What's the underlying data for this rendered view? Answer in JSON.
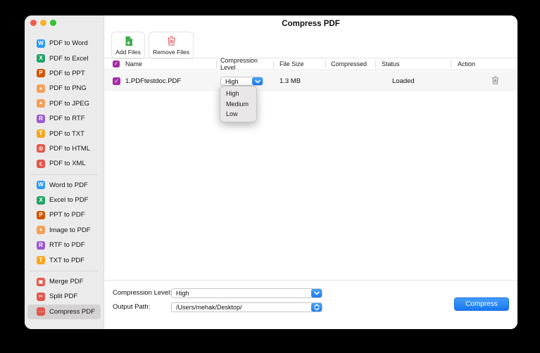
{
  "window": {
    "title": "Compress PDF"
  },
  "toolbar": {
    "add_files_label": "Add Files",
    "remove_files_label": "Remove Files"
  },
  "sidebar": {
    "groups": [
      {
        "items": [
          {
            "label": "PDF to Word",
            "glyph": "W",
            "color": "#2b9af3"
          },
          {
            "label": "PDF to Excel",
            "glyph": "X",
            "color": "#21a366"
          },
          {
            "label": "PDF to PPT",
            "glyph": "P",
            "color": "#d35400"
          },
          {
            "label": "PDF to PNG",
            "glyph": "▲",
            "color": "#f5a05a"
          },
          {
            "label": "PDF to JPEG",
            "glyph": "▲",
            "color": "#f5a05a"
          },
          {
            "label": "PDF to RTF",
            "glyph": "R",
            "color": "#9b59d0"
          },
          {
            "label": "PDF to TXT",
            "glyph": "T",
            "color": "#f6a821"
          },
          {
            "label": "PDF to HTML",
            "glyph": "⊕",
            "color": "#e2574c"
          },
          {
            "label": "PDF to XML",
            "glyph": "ς",
            "color": "#e2574c"
          }
        ]
      },
      {
        "items": [
          {
            "label": "Word to PDF",
            "glyph": "W",
            "color": "#2b9af3"
          },
          {
            "label": "Excel to PDF",
            "glyph": "X",
            "color": "#21a366"
          },
          {
            "label": "PPT to PDF",
            "glyph": "P",
            "color": "#d35400"
          },
          {
            "label": "Image to PDF",
            "glyph": "▲",
            "color": "#f5a05a"
          },
          {
            "label": "RTF to PDF",
            "glyph": "R",
            "color": "#9b59d0"
          },
          {
            "label": "TXT to PDF",
            "glyph": "T",
            "color": "#f6a821"
          }
        ]
      },
      {
        "items": [
          {
            "label": "Merge PDF",
            "glyph": "▣",
            "color": "#e2574c"
          },
          {
            "label": "Split PDF",
            "glyph": "✂",
            "color": "#e2574c"
          },
          {
            "label": "Compress PDF",
            "glyph": "→←",
            "color": "#e2574c",
            "selected": true
          }
        ]
      }
    ]
  },
  "table": {
    "columns": [
      "Name",
      "Compression Level",
      "File Size",
      "Compressed",
      "Status",
      "Action"
    ],
    "row": {
      "name": "1.PDFtestdoc.PDF",
      "compression_level": "High",
      "file_size": "1.3 MB",
      "compressed": "",
      "status": "Loaded"
    }
  },
  "compression_menu": {
    "options": [
      "High",
      "Medium",
      "Low"
    ]
  },
  "footer": {
    "compression_level_label": "Compression Level:",
    "compression_level_value": "High",
    "output_path_label": "Output Path:",
    "output_path_value": "/Users/mehak/Desktop/",
    "compress_label": "Compress"
  },
  "colors": {
    "accent_blue": "#1d7bf0",
    "checkbox_purple": "#a62ba6",
    "add_icon_green": "#3bae49",
    "remove_icon_red": "#e25c5c",
    "sidebar_bg": "#ecebeb",
    "sidebar_selected_bg": "#d4d2d2",
    "row_bg": "#f6f6f6",
    "menu_bg": "#e9e7e7"
  }
}
